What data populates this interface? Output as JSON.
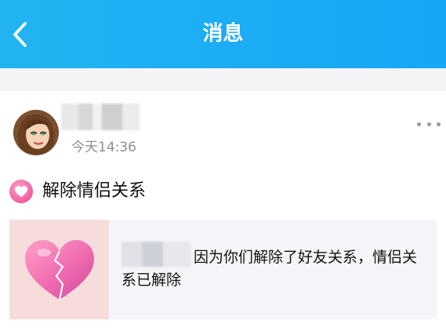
{
  "header": {
    "title": "消息",
    "back_icon": "chevron-left-icon",
    "background_color": "#1aadf4"
  },
  "message": {
    "avatar_icon": "avatar",
    "timestamp": "今天14:36",
    "more_icon": "more-horizontal-icon",
    "action_text": "解除情侣关系",
    "action_icon": "heart-badge-icon",
    "info_text": "因为你们解除了好友关系，情侣关系已解除",
    "info_image": "broken-heart-icon"
  }
}
